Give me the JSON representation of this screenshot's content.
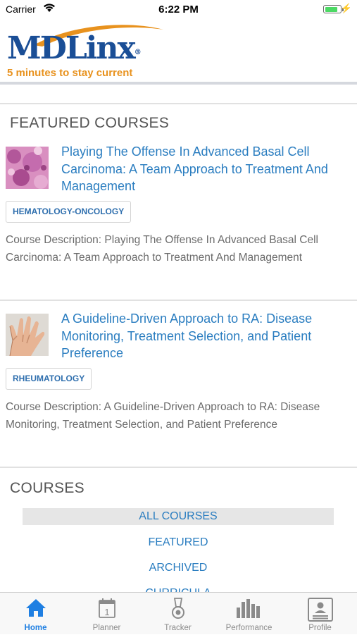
{
  "status_bar": {
    "carrier": "Carrier",
    "time": "6:22 PM",
    "battery_level": 0.8
  },
  "header": {
    "logo_text": "MDLinx",
    "logo_registered": "®",
    "tagline": "5 minutes to stay current",
    "colors": {
      "logo_blue": "#1a4e96",
      "tagline_orange": "#e8921e"
    }
  },
  "featured": {
    "section_title": "FEATURED COURSES",
    "courses": [
      {
        "title": "Playing The Offense In Advanced Basal Cell Carcinoma: A Team Approach to Treatment And Management",
        "tag": "HEMATOLOGY-ONCOLOGY",
        "description": "Course Description: Playing The Offense In Advanced Basal Cell Carcinoma: A Team Approach to Treatment And Management",
        "thumbnail_icon": "histology-image-icon"
      },
      {
        "title": "A Guideline-Driven Approach to RA: Disease Monitoring, Treatment Selection, and Patient Preference",
        "tag": "RHEUMATOLOGY",
        "description": "Course Description: A Guideline-Driven Approach to RA: Disease Monitoring, Treatment Selection, and Patient Preference",
        "thumbnail_icon": "hand-photo-icon"
      }
    ]
  },
  "courses": {
    "section_title": "COURSES",
    "menu": [
      {
        "label": "ALL COURSES",
        "selected": true
      },
      {
        "label": "FEATURED",
        "selected": false
      },
      {
        "label": "ARCHIVED",
        "selected": false
      },
      {
        "label": "CURRICULA",
        "selected": false
      }
    ]
  },
  "tab_bar": {
    "active_color": "#1f7fe2",
    "tabs": [
      {
        "label": "Home",
        "icon": "home-icon",
        "active": true
      },
      {
        "label": "Planner",
        "icon": "calendar-icon",
        "active": false
      },
      {
        "label": "Tracker",
        "icon": "medal-icon",
        "active": false
      },
      {
        "label": "Performance",
        "icon": "bar-chart-icon",
        "active": false
      },
      {
        "label": "Profile",
        "icon": "profile-card-icon",
        "active": false
      }
    ]
  }
}
